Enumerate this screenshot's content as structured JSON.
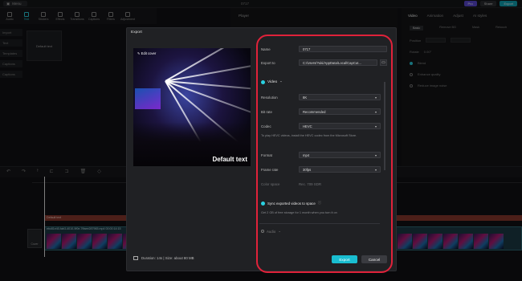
{
  "app": {
    "menu_label": "Menu",
    "project_name": "0717",
    "pro_label": "Pro",
    "share_label": "Share",
    "export_label": "Export"
  },
  "toolbar": [
    "Audio",
    "Text",
    "Stickers",
    "Effects",
    "Transitions",
    "Captions",
    "Filters",
    "Adjustment"
  ],
  "left_categories": [
    "Import",
    "Text",
    "Templates",
    "Captions",
    "Captions"
  ],
  "default_tile": "Default text",
  "player": {
    "title": "Player"
  },
  "right_panel": {
    "tabs": [
      "Video",
      "Animation",
      "Adjust",
      "AI styles"
    ],
    "subtabs": [
      "Basic",
      "Remove BG",
      "Mask",
      "Retouch"
    ],
    "rows": [
      "Position",
      "Rotate",
      "Blend",
      "Enhance quality",
      "Reduce image noise"
    ],
    "rotate_value": "0.00°"
  },
  "timeline": {
    "text_clip": "Default text",
    "video_clip": "ebc81e40-fab3-4010-9f0e-7ffaee287965.mp4   00:00:14:15",
    "cover_label": "Cover"
  },
  "export_dialog": {
    "title": "Export",
    "edit_cover": "✎ Edit cover",
    "preview_text": "Default text",
    "duration": "Duration: 14s | Size: about 80 MB",
    "name_label": "Name",
    "name_value": "0717",
    "export_to_label": "Export to",
    "export_to_value": "C:/Users/Yuki/AppData/Local/CapCut...",
    "video_section": "Video",
    "resolution_label": "Resolution",
    "resolution_value": "8K",
    "bitrate_label": "Bit rate",
    "bitrate_value": "Recommended",
    "codec_label": "Codec",
    "codec_value": "HEVC",
    "codec_note": "To play HEVC videos, install the HEVC codec from the Microsoft Store.",
    "format_label": "Format",
    "format_value": "mp4",
    "framerate_label": "Frame rate",
    "framerate_value": "30fps",
    "colorspace_label": "Color space",
    "colorspace_value": "Rec. 709 SDR",
    "sync_label": "Sync exported videos to space",
    "sync_note": "Get 2 GB of free storage for 1 month when you turn it on",
    "audio_section": "Audio",
    "export_button": "Export",
    "cancel_button": "Cancel"
  },
  "colors": {
    "accent": "#19bdd0",
    "highlight_ring": "#e0223a",
    "dialog_bg": "#202124"
  }
}
